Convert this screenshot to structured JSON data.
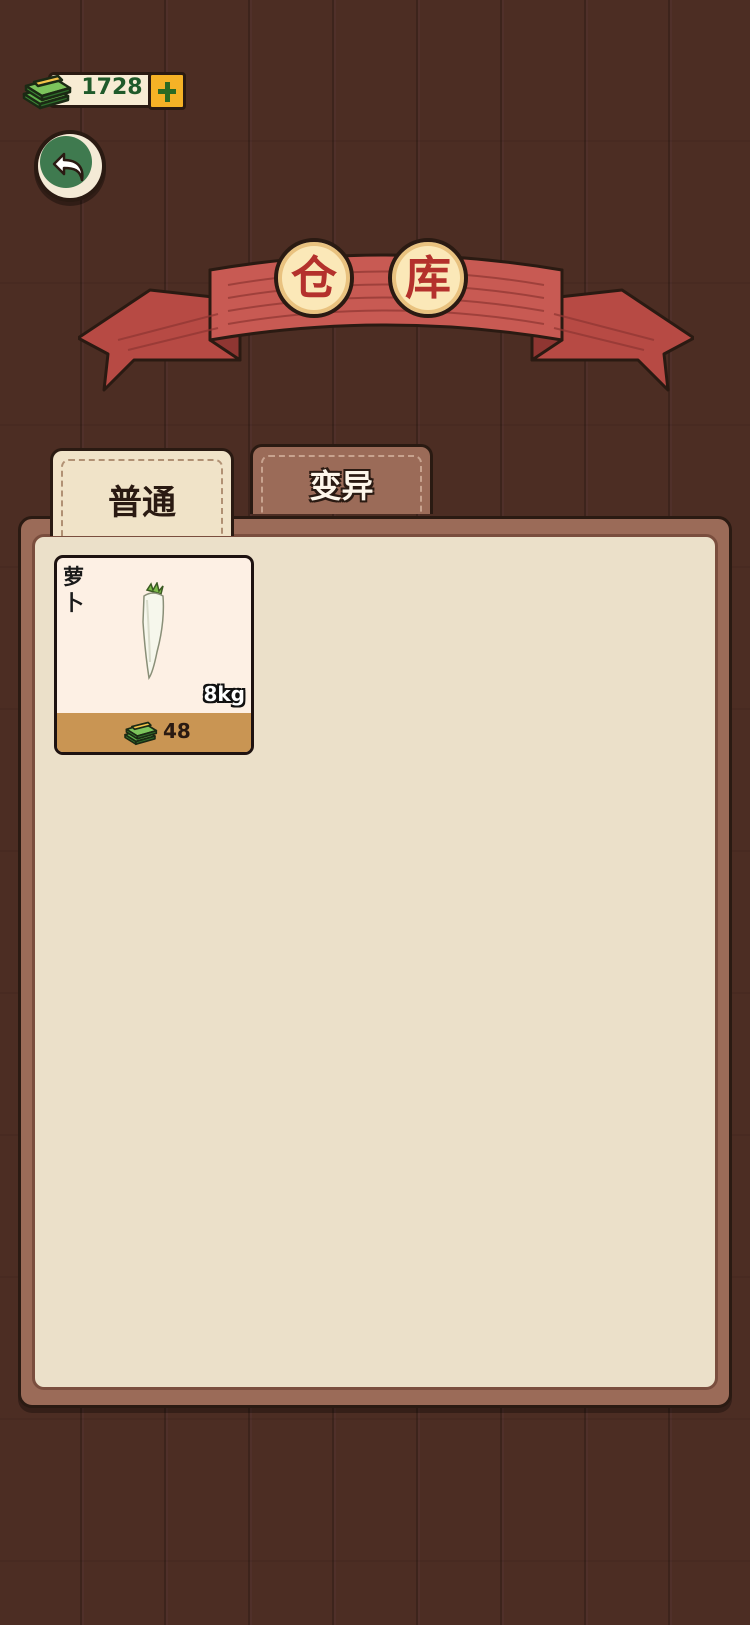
{
  "header": {
    "currency": {
      "value": "1728",
      "icon": "cash-stack-icon"
    },
    "add_currency": {
      "icon": "plus-icon"
    },
    "back": {
      "icon": "back-arrow-icon"
    }
  },
  "title": {
    "chars": [
      "仓",
      "库"
    ]
  },
  "tabs": [
    {
      "label": "普通",
      "active": true
    },
    {
      "label": "变异",
      "active": false
    }
  ],
  "inventory": {
    "items": [
      {
        "name": "萝卜",
        "weight": "8kg",
        "price": "48",
        "image_icon": "white-radish-icon",
        "price_icon": "cash-stack-icon"
      }
    ]
  },
  "colors": {
    "wood_bg": "#4a2c22",
    "panel_border": "#9b6b58",
    "panel_fill": "#ebe0c9",
    "banner_red": "#c0544f",
    "title_text": "#b4312c",
    "money_green": "#1f5a2a",
    "plus_yellow": "#f5b226",
    "card_footer": "#c99553"
  }
}
